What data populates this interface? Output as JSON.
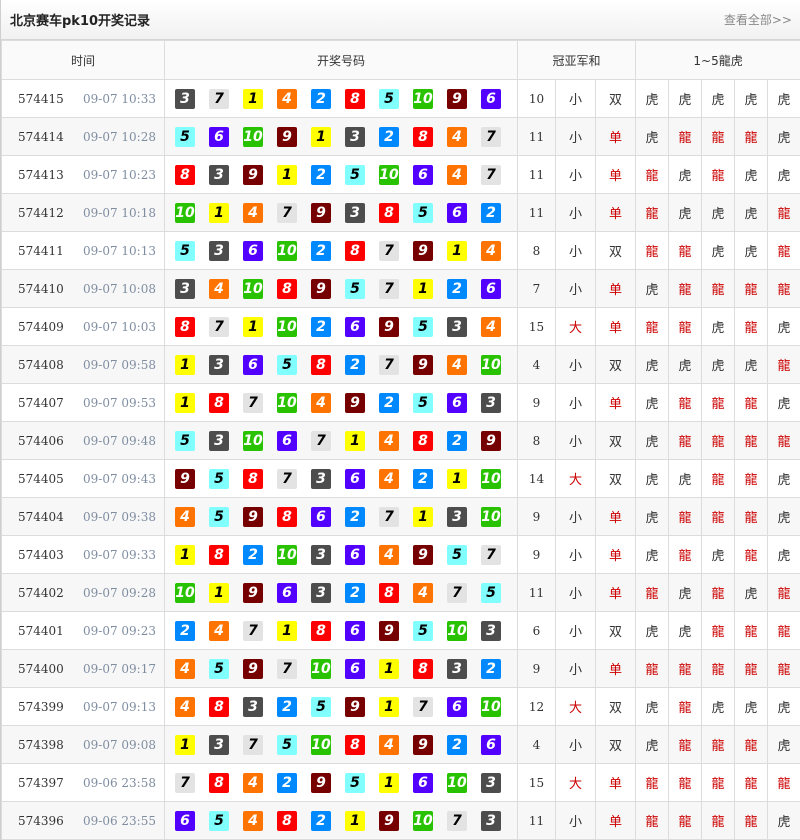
{
  "header": {
    "title": "北京赛车pk10开奖记录",
    "more_link": "查看全部>>"
  },
  "columns": {
    "time": "时间",
    "numbers": "开奖号码",
    "sum": "冠亚军和",
    "dragon_tiger": "1~5龍虎"
  },
  "colors": {
    "red": "#cc0000",
    "normal": "#333333"
  },
  "rows": [
    {
      "issue": "574415",
      "time": "09-07 10:33",
      "nums": [
        3,
        7,
        1,
        4,
        2,
        8,
        5,
        10,
        9,
        6
      ],
      "sum": "10",
      "size": "小",
      "parity": "双",
      "dt": [
        "虎",
        "虎",
        "虎",
        "虎",
        "虎"
      ]
    },
    {
      "issue": "574414",
      "time": "09-07 10:28",
      "nums": [
        5,
        6,
        10,
        9,
        1,
        3,
        2,
        8,
        4,
        7
      ],
      "sum": "11",
      "size": "小",
      "parity": "单",
      "dt": [
        "虎",
        "龍",
        "龍",
        "龍",
        "虎"
      ]
    },
    {
      "issue": "574413",
      "time": "09-07 10:23",
      "nums": [
        8,
        3,
        9,
        1,
        2,
        5,
        10,
        6,
        4,
        7
      ],
      "sum": "11",
      "size": "小",
      "parity": "单",
      "dt": [
        "龍",
        "虎",
        "龍",
        "虎",
        "虎"
      ]
    },
    {
      "issue": "574412",
      "time": "09-07 10:18",
      "nums": [
        10,
        1,
        4,
        7,
        9,
        3,
        8,
        5,
        6,
        2
      ],
      "sum": "11",
      "size": "小",
      "parity": "单",
      "dt": [
        "龍",
        "虎",
        "虎",
        "虎",
        "龍"
      ]
    },
    {
      "issue": "574411",
      "time": "09-07 10:13",
      "nums": [
        5,
        3,
        6,
        10,
        2,
        8,
        7,
        9,
        1,
        4
      ],
      "sum": "8",
      "size": "小",
      "parity": "双",
      "dt": [
        "龍",
        "龍",
        "虎",
        "虎",
        "龍"
      ]
    },
    {
      "issue": "574410",
      "time": "09-07 10:08",
      "nums": [
        3,
        4,
        10,
        8,
        9,
        5,
        7,
        1,
        2,
        6
      ],
      "sum": "7",
      "size": "小",
      "parity": "单",
      "dt": [
        "虎",
        "龍",
        "龍",
        "龍",
        "龍"
      ]
    },
    {
      "issue": "574409",
      "time": "09-07 10:03",
      "nums": [
        8,
        7,
        1,
        10,
        2,
        6,
        9,
        5,
        3,
        4
      ],
      "sum": "15",
      "size": "大",
      "parity": "单",
      "dt": [
        "龍",
        "龍",
        "虎",
        "龍",
        "虎"
      ]
    },
    {
      "issue": "574408",
      "time": "09-07 09:58",
      "nums": [
        1,
        3,
        6,
        5,
        8,
        2,
        7,
        9,
        4,
        10
      ],
      "sum": "4",
      "size": "小",
      "parity": "双",
      "dt": [
        "虎",
        "虎",
        "虎",
        "虎",
        "龍"
      ]
    },
    {
      "issue": "574407",
      "time": "09-07 09:53",
      "nums": [
        1,
        8,
        7,
        10,
        4,
        9,
        2,
        5,
        6,
        3
      ],
      "sum": "9",
      "size": "小",
      "parity": "单",
      "dt": [
        "虎",
        "龍",
        "龍",
        "龍",
        "虎"
      ]
    },
    {
      "issue": "574406",
      "time": "09-07 09:48",
      "nums": [
        5,
        3,
        10,
        6,
        7,
        1,
        4,
        8,
        2,
        9
      ],
      "sum": "8",
      "size": "小",
      "parity": "双",
      "dt": [
        "虎",
        "龍",
        "龍",
        "龍",
        "龍"
      ]
    },
    {
      "issue": "574405",
      "time": "09-07 09:43",
      "nums": [
        9,
        5,
        8,
        7,
        3,
        6,
        4,
        2,
        1,
        10
      ],
      "sum": "14",
      "size": "大",
      "parity": "双",
      "dt": [
        "虎",
        "虎",
        "龍",
        "龍",
        "虎"
      ]
    },
    {
      "issue": "574404",
      "time": "09-07 09:38",
      "nums": [
        4,
        5,
        9,
        8,
        6,
        2,
        7,
        1,
        3,
        10
      ],
      "sum": "9",
      "size": "小",
      "parity": "单",
      "dt": [
        "虎",
        "龍",
        "龍",
        "龍",
        "虎"
      ]
    },
    {
      "issue": "574403",
      "time": "09-07 09:33",
      "nums": [
        1,
        8,
        2,
        10,
        3,
        6,
        4,
        9,
        5,
        7
      ],
      "sum": "9",
      "size": "小",
      "parity": "单",
      "dt": [
        "虎",
        "龍",
        "虎",
        "龍",
        "虎"
      ]
    },
    {
      "issue": "574402",
      "time": "09-07 09:28",
      "nums": [
        10,
        1,
        9,
        6,
        3,
        2,
        8,
        4,
        7,
        5
      ],
      "sum": "11",
      "size": "小",
      "parity": "单",
      "dt": [
        "龍",
        "虎",
        "龍",
        "虎",
        "龍"
      ]
    },
    {
      "issue": "574401",
      "time": "09-07 09:23",
      "nums": [
        2,
        4,
        7,
        1,
        8,
        6,
        9,
        5,
        10,
        3
      ],
      "sum": "6",
      "size": "小",
      "parity": "双",
      "dt": [
        "虎",
        "虎",
        "龍",
        "龍",
        "龍"
      ]
    },
    {
      "issue": "574400",
      "time": "09-07 09:17",
      "nums": [
        4,
        5,
        9,
        7,
        10,
        6,
        1,
        8,
        3,
        2
      ],
      "sum": "9",
      "size": "小",
      "parity": "单",
      "dt": [
        "龍",
        "龍",
        "龍",
        "龍",
        "龍"
      ]
    },
    {
      "issue": "574399",
      "time": "09-07 09:13",
      "nums": [
        4,
        8,
        3,
        2,
        5,
        9,
        1,
        7,
        6,
        10
      ],
      "sum": "12",
      "size": "大",
      "parity": "双",
      "dt": [
        "虎",
        "龍",
        "虎",
        "虎",
        "虎"
      ]
    },
    {
      "issue": "574398",
      "time": "09-07 09:08",
      "nums": [
        1,
        3,
        7,
        5,
        10,
        8,
        4,
        9,
        2,
        6
      ],
      "sum": "4",
      "size": "小",
      "parity": "双",
      "dt": [
        "虎",
        "龍",
        "龍",
        "龍",
        "虎"
      ]
    },
    {
      "issue": "574397",
      "time": "09-06 23:58",
      "nums": [
        7,
        8,
        4,
        2,
        9,
        5,
        1,
        6,
        10,
        3
      ],
      "sum": "15",
      "size": "大",
      "parity": "单",
      "dt": [
        "龍",
        "龍",
        "龍",
        "龍",
        "龍"
      ]
    },
    {
      "issue": "574396",
      "time": "09-06 23:55",
      "nums": [
        6,
        5,
        4,
        8,
        2,
        1,
        9,
        10,
        7,
        3
      ],
      "sum": "11",
      "size": "小",
      "parity": "单",
      "dt": [
        "龍",
        "龍",
        "龍",
        "龍",
        "虎"
      ]
    }
  ]
}
